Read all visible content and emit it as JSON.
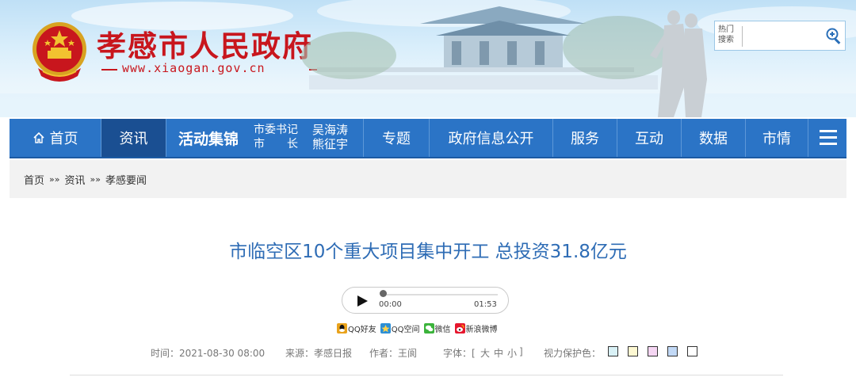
{
  "header": {
    "site_title": "孝感市人民政府",
    "site_url": "www.xiaogan.gov.cn",
    "search": {
      "hot_label": "热门",
      "search_label": "搜索",
      "placeholder": ""
    }
  },
  "nav": {
    "home": "首页",
    "news": "资讯",
    "activities": "活动集锦",
    "leader_title_1": "市委书记",
    "leader_title_2": "市　　长",
    "leader_name_1": "吴海涛",
    "leader_name_2": "熊征宇",
    "topics": "专题",
    "gov_info": "政府信息公开",
    "service": "服务",
    "interaction": "互动",
    "data": "数据",
    "city": "市情"
  },
  "breadcrumb": {
    "items": [
      "首页",
      "资讯",
      "孝感要闻"
    ],
    "separator": "»»"
  },
  "article": {
    "title": "市临空区10个重大项目集中开工 总投资31.8亿元",
    "audio": {
      "current_time": "00:00",
      "duration": "01:53",
      "progress": 0
    },
    "share": [
      "QQ好友",
      "QQ空间",
      "微信",
      "新浪微博"
    ],
    "meta": {
      "time": "时间：2021-08-30 08:00",
      "source": "来源：孝感日报",
      "author": "作者：王阆",
      "font_size_label": "字体：[",
      "font_large": "大",
      "font_medium": "中",
      "font_small": "小",
      "font_size_end": "]",
      "eye_care_label": "视力保护色："
    }
  },
  "colors": {
    "brand_red": "#c8161d",
    "nav_blue": "#2b74c6",
    "nav_active": "#1a4f92",
    "title_blue": "#2e6cb5",
    "eye_care": [
      "#d9f1f6",
      "#fdf8d2",
      "#f5d6f3",
      "#c2d9f6",
      "#ffffff"
    ]
  },
  "icons": {
    "home": "home-icon",
    "search": "magnifier-plus-icon",
    "menu": "hamburger-menu-icon",
    "play": "play-icon"
  }
}
